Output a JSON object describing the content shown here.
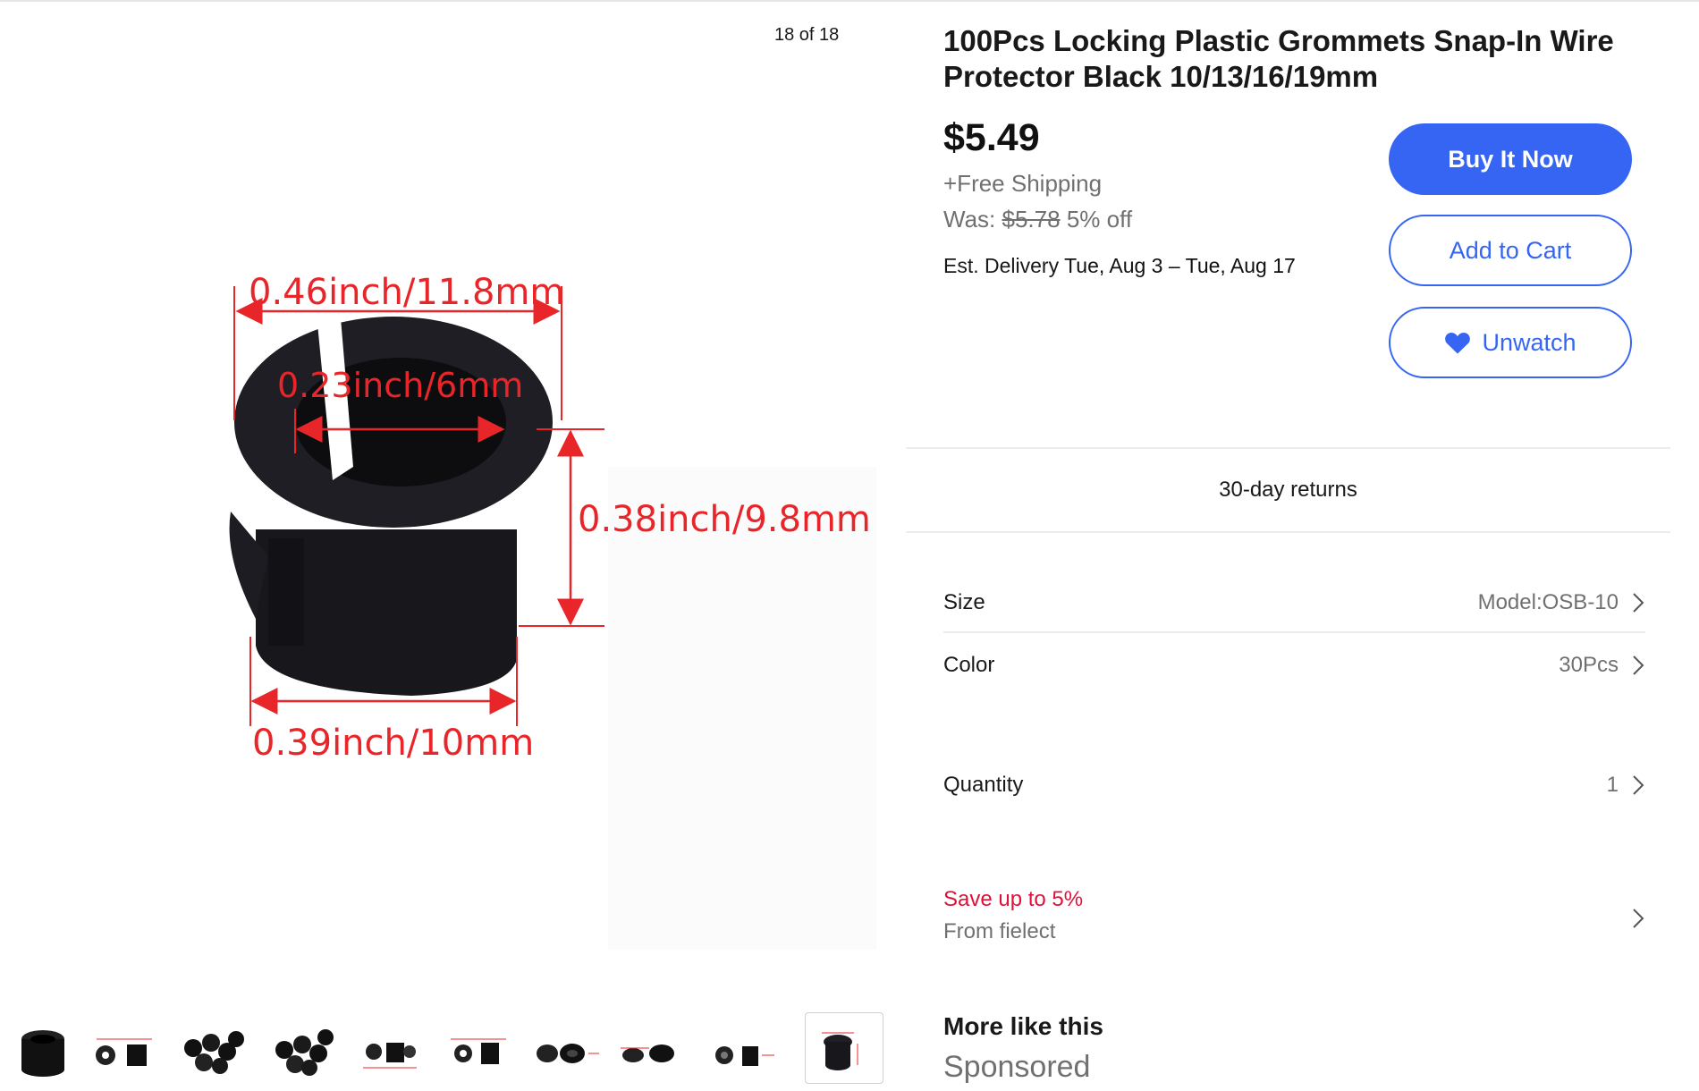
{
  "gallery": {
    "counter": "18 of 18",
    "image_alt": "Black locking plastic grommet with red dimension labels",
    "dimensions": {
      "top_width": "0.46inch/11.8mm",
      "inner_diameter": "0.23inch/6mm",
      "height": "0.38inch/9.8mm",
      "bottom_width": "0.39inch/10mm"
    },
    "thumbnails_count": 10
  },
  "listing": {
    "title": "100Pcs Locking Plastic Grommets Snap-In Wire Protector Black 10/13/16/19mm",
    "price": "$5.49",
    "shipping": "+Free Shipping",
    "was_label": "Was:",
    "was_price": "$5.78",
    "discount": "5% off",
    "delivery_label": "Est. Delivery",
    "delivery_dates": "Tue, Aug 3 – Tue, Aug 17"
  },
  "actions": {
    "buy_now": "Buy It Now",
    "add_to_cart": "Add to Cart",
    "unwatch": "Unwatch"
  },
  "returns": "30-day returns",
  "options": {
    "size": {
      "label": "Size",
      "value": "Model:OSB-10"
    },
    "color": {
      "label": "Color",
      "value": "30Pcs"
    },
    "quantity": {
      "label": "Quantity",
      "value": "1"
    }
  },
  "promo": {
    "headline": "Save up to 5%",
    "seller": "From fielect"
  },
  "more_like_this": {
    "heading": "More like this",
    "sponsored": "Sponsored"
  },
  "colors": {
    "accent": "#3665f3",
    "promo": "#e0103a",
    "dimension_red": "#e8262a",
    "muted_text": "#707070"
  }
}
